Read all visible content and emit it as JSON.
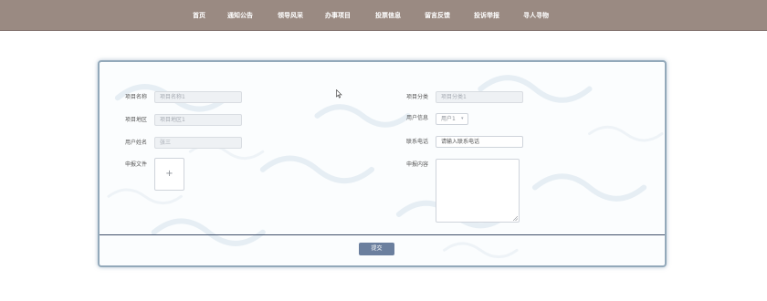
{
  "nav": {
    "items": [
      {
        "label": "首页"
      },
      {
        "label": "通知公告"
      },
      {
        "label": "领导风采"
      },
      {
        "label": "办事项目"
      },
      {
        "label": "投票信息"
      },
      {
        "label": "留言反馈"
      },
      {
        "label": "投诉举报"
      },
      {
        "label": "寻人寻物"
      }
    ]
  },
  "form": {
    "project_name": {
      "label": "项目名称",
      "value": "项目名称1"
    },
    "project_category": {
      "label": "项目分类",
      "value": "项目分类1"
    },
    "project_region": {
      "label": "项目地区",
      "value": "项目地区1"
    },
    "user_info": {
      "label": "用户信息",
      "value": "用户1"
    },
    "user_name": {
      "label": "用户姓名",
      "value": "张三"
    },
    "contact_phone": {
      "label": "联系电话",
      "placeholder": "请输入联系电话"
    },
    "report_file": {
      "label": "申报文件",
      "add_symbol": "+"
    },
    "report_content": {
      "label": "申报内容"
    },
    "submit_label": "提交"
  },
  "colors": {
    "nav_bg": "#9a8a82",
    "card_border": "#93a9ba",
    "button_bg": "#6b7f9e",
    "divider": "#3f4f6a"
  },
  "icons": {
    "mouse_cursor": "cursor-icon",
    "select_dropdown": "chevron-down-icon",
    "textarea_resize": "resize-grip-icon"
  }
}
